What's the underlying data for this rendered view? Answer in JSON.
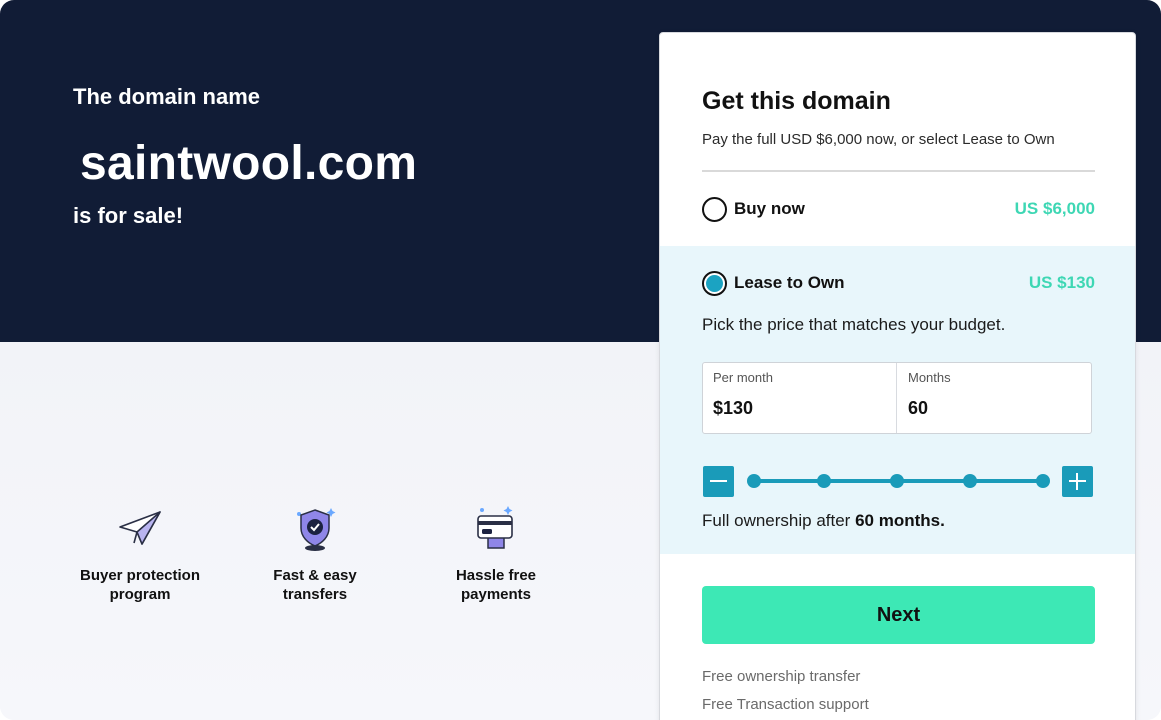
{
  "hero": {
    "label": "The domain name",
    "domain": "saintwool.com",
    "sale_text": "is for sale!"
  },
  "features": [
    {
      "icon": "paper-plane-icon",
      "title_line1": "Buyer protection",
      "title_line2": "program"
    },
    {
      "icon": "shield-check-icon",
      "title_line1": "Fast & easy",
      "title_line2": "transfers"
    },
    {
      "icon": "credit-card-icon",
      "title_line1": "Hassle free",
      "title_line2": "payments"
    }
  ],
  "card": {
    "title": "Get this domain",
    "subtitle": "Pay the full USD $6,000 now, or select Lease to Own",
    "buy": {
      "label": "Buy now",
      "price": "US $6,000",
      "selected": false
    },
    "lease": {
      "label": "Lease to Own",
      "price": "US $130",
      "selected": true,
      "description": "Pick the price that matches your budget.",
      "per_month_label": "Per month",
      "per_month_value": "$130",
      "months_label": "Months",
      "months_value": "60",
      "slider_steps": 5,
      "slider_selected_step": 5,
      "ownership_prefix": "Full ownership after",
      "ownership_value": "60 months."
    },
    "next_label": "Next",
    "perks": [
      "Free ownership transfer",
      "Free Transaction support"
    ]
  },
  "colors": {
    "hero_bg": "#111c36",
    "accent_teal": "#1a9bb9",
    "price_green": "#3ed7b4",
    "next_button": "#3de8b5",
    "lease_panel_bg": "#e8f6fb"
  }
}
